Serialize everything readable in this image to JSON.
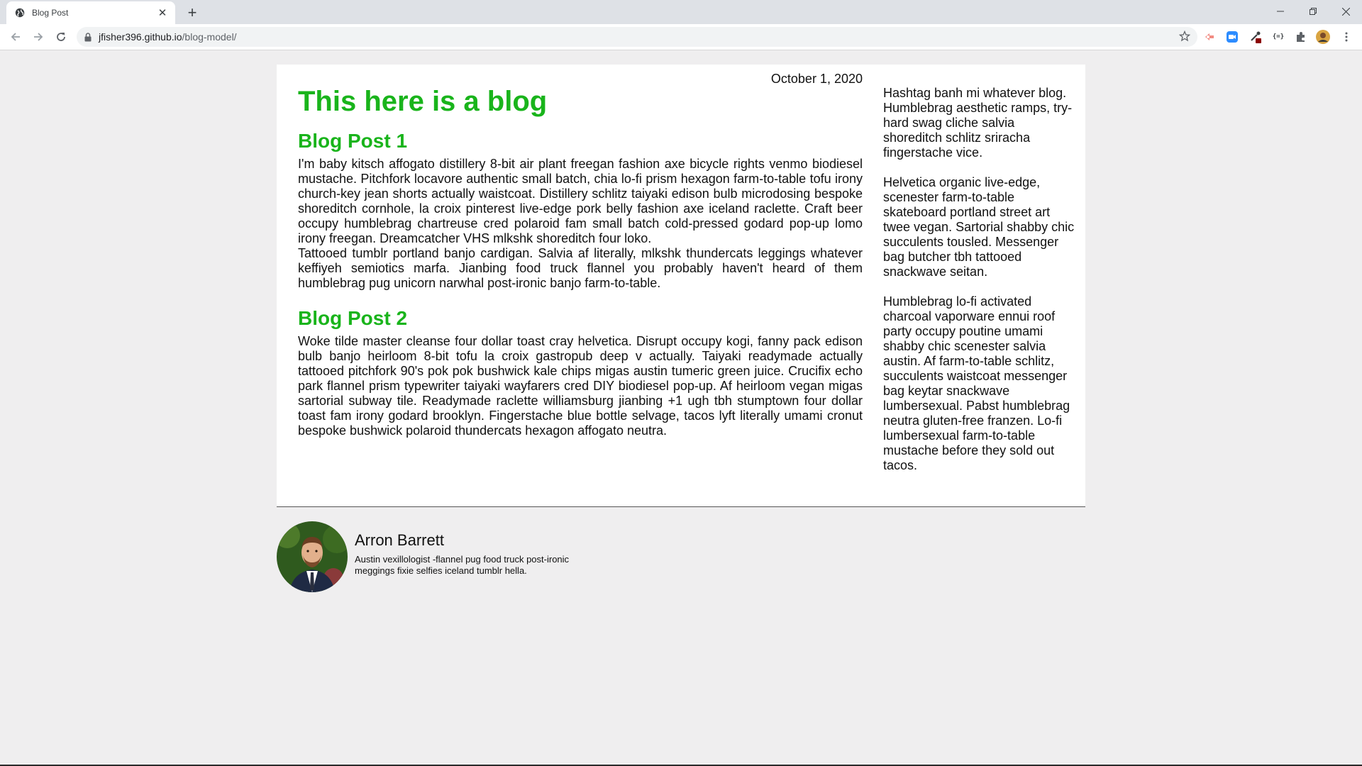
{
  "browser": {
    "tab_title": "Blog Post",
    "new_tab_label": "+",
    "url_host": "jfisher396.github.io",
    "url_path": "/blog-model/"
  },
  "blog": {
    "date": "October 1, 2020",
    "title": "This here is a blog",
    "posts": [
      {
        "heading": "Blog Post 1",
        "paragraphs": [
          "I'm baby kitsch affogato distillery 8-bit air plant freegan fashion axe bicycle rights venmo biodiesel mustache. Pitchfork locavore authentic small batch, chia lo-fi prism hexagon farm-to-table tofu irony church-key jean shorts actually waistcoat. Distillery schlitz taiyaki edison bulb microdosing bespoke shoreditch cornhole, la croix pinterest live-edge pork belly fashion axe iceland raclette. Craft beer occupy humblebrag chartreuse cred polaroid fam small batch cold-pressed godard pop-up lomo irony freegan. Dreamcatcher VHS mlkshk shoreditch four loko.",
          "Tattooed tumblr portland banjo cardigan. Salvia af literally, mlkshk thundercats leggings whatever keffiyeh semiotics marfa. Jianbing food truck flannel you probably haven't heard of them humblebrag pug unicorn narwhal post-ironic banjo farm-to-table."
        ]
      },
      {
        "heading": "Blog Post 2",
        "paragraphs": [
          "Woke tilde master cleanse four dollar toast cray helvetica. Disrupt occupy kogi, fanny pack edison bulb banjo heirloom 8-bit tofu la croix gastropub deep v actually. Taiyaki readymade actually tattooed pitchfork 90's pok pok bushwick kale chips migas austin tumeric green juice. Crucifix echo park flannel prism typewriter taiyaki wayfarers cred DIY biodiesel pop-up. Af heirloom vegan migas sartorial subway tile. Readymade raclette williamsburg jianbing +1 ugh tbh stumptown four dollar toast fam irony godard brooklyn. Fingerstache blue bottle selvage, tacos lyft literally umami cronut bespoke bushwick polaroid thundercats hexagon affogato neutra."
        ]
      }
    ],
    "sidebar": [
      "Hashtag banh mi whatever blog. Humblebrag aesthetic ramps, try-hard swag cliche salvia shoreditch schlitz sriracha fingerstache vice.",
      "Helvetica organic live-edge, scenester farm-to-table skateboard portland street art twee vegan. Sartorial shabby chic succulents tousled. Messenger bag butcher tbh tattooed snackwave seitan.",
      "Humblebrag lo-fi activated charcoal vaporware ennui roof party occupy poutine umami shabby chic scenester salvia austin. Af farm-to-table schlitz, succulents waistcoat messenger bag keytar snackwave lumbersexual. Pabst humblebrag neutra gluten-free franzen. Lo-fi lumbersexual farm-to-table mustache before they sold out tacos."
    ]
  },
  "author": {
    "name": "Arron Barrett",
    "bio": "Austin vexillologist -flannel pug food truck post-ironic meggings fixie selfies iceland tumblr hella."
  },
  "colors": {
    "heading_green": "#19b41b",
    "page_background": "#efeeef"
  }
}
